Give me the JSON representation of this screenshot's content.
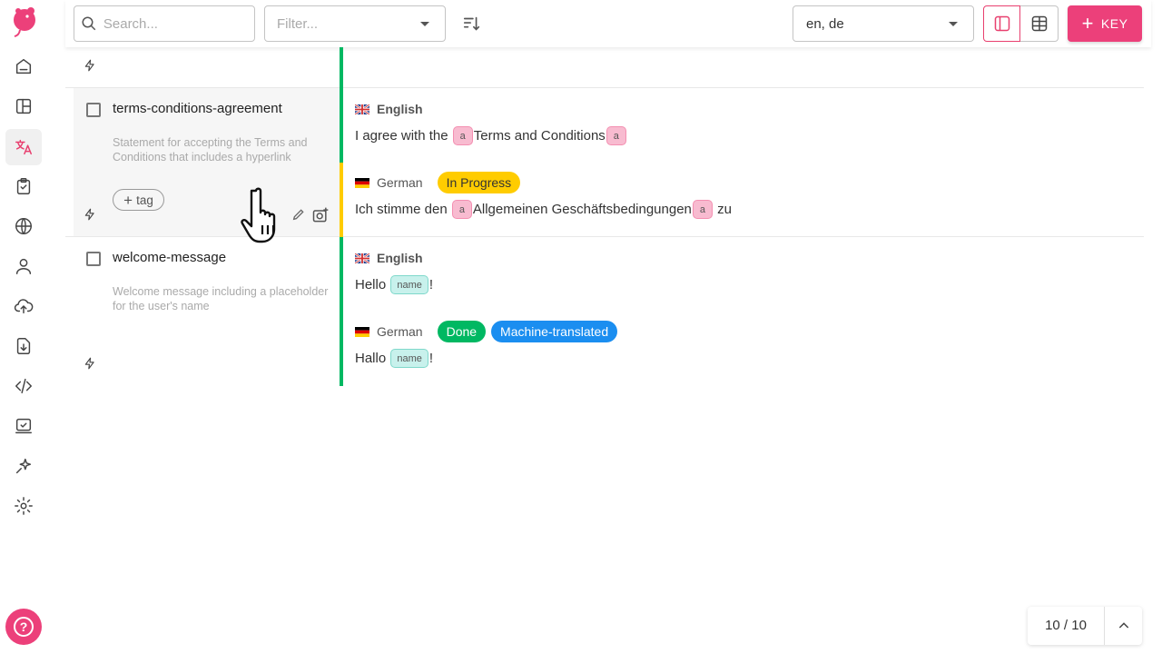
{
  "toolbar": {
    "search_placeholder": "Search...",
    "filter_placeholder": "Filter...",
    "language_select": "en, de",
    "add_key_label": "KEY"
  },
  "sidebar": {
    "items": [
      {
        "icon": "home-icon"
      },
      {
        "icon": "dashboard-icon"
      },
      {
        "icon": "translations-icon",
        "active": true
      },
      {
        "icon": "tasks-icon"
      },
      {
        "icon": "languages-globe-icon"
      },
      {
        "icon": "members-icon"
      },
      {
        "icon": "import-icon"
      },
      {
        "icon": "export-icon"
      },
      {
        "icon": "developer-icon"
      },
      {
        "icon": "integrate-icon"
      },
      {
        "icon": "ai-icon"
      },
      {
        "icon": "settings-icon"
      }
    ]
  },
  "keys": [
    {
      "name": "terms-conditions-agreement",
      "description": "Statement for accepting the Terms and Conditions that includes a hyperlink",
      "add_tag_label": "tag",
      "translations": [
        {
          "language": "English",
          "base": true,
          "text_before": "I agree with the",
          "tag_open": "a",
          "link_text": "Terms and Conditions",
          "tag_close": "a"
        },
        {
          "language": "German",
          "badges": [
            "In Progress"
          ],
          "text_before": "Ich stimme den",
          "tag_open": "a",
          "link_text": "Allgemeinen Geschäftsbedingungen",
          "tag_close": "a",
          "text_after": "zu"
        }
      ]
    },
    {
      "name": "welcome-message",
      "description": "Welcome message including a placeholder for the user's name",
      "translations": [
        {
          "language": "English",
          "base": true,
          "text_before": "Hello",
          "variable": "name",
          "text_after": "!"
        },
        {
          "language": "German",
          "badges": [
            "Done",
            "Machine-translated"
          ],
          "text_before": "Hallo",
          "variable": "name",
          "text_after": "!"
        }
      ]
    }
  ],
  "pagination": {
    "count": "10 / 10"
  },
  "colors": {
    "accent": "#ec407a",
    "state_done": "#00b862",
    "state_in_progress": "#ffcc00",
    "machine_translated": "#1b8ef0"
  }
}
